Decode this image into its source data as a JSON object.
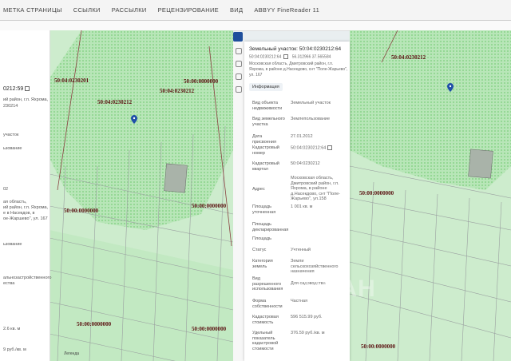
{
  "ribbon": {
    "tabs": [
      "МЕТКА СТРАНИЦЫ",
      "ССЫЛКИ",
      "РАССЫЛКИ",
      "РЕЦЕНЗИРОВАНИЕ",
      "ВИД",
      "ABBYY FineReader 11"
    ]
  },
  "sidebar": {
    "cadastral_number": "0212:59",
    "lines": [
      "ий район, г.п. Яхрома,",
      "230214",
      "участок",
      "",
      "ьзование",
      "",
      "",
      "02",
      "ая область,",
      "ий район, г.п. Яхрома,",
      "е в Насекдов, в",
      "ое-Жаршево\", ул. 167",
      "",
      "ьзование",
      "",
      "",
      "",
      "альнозастройственного",
      "ества",
      "",
      "",
      "",
      "",
      "",
      "",
      "2.6 кв. м",
      "",
      "",
      "9 руб./кв. м"
    ]
  },
  "card": {
    "title": "Земельный участок: 50:04:0230212:64",
    "sub_cadastral": "50:04:0230212:64",
    "sub_coords": "56.312966 37.565584",
    "address_line": "Московская область, Дмитровский район, г.п. Яхрома, в районе д.Насекдово, снт \"Поле-Жарьево\", ул. 167",
    "tab_label": "Информация",
    "rows": [
      {
        "k": "Вид объекта недвижимости",
        "v": "Земельный участок"
      },
      {
        "k": "Вид земельного участка",
        "v": "Землепользование"
      },
      {
        "k": "Дата присвоения",
        "v": "27.01.2012"
      },
      {
        "k": "Кадастровый номер",
        "v": "50:04:0230212:64"
      },
      {
        "k": "Кадастровый квартал",
        "v": "50:04:0230212"
      },
      {
        "k": "Адрес",
        "v": "Московская область, Дмитровский район, г.п. Яхрома, в районе д.Насекдово, снт \"Поле-Жарьево\", ул.158"
      },
      {
        "k": "Площадь уточненная",
        "v": "1 001 кв. м"
      },
      {
        "k": "Площадь декларированная",
        "v": ""
      },
      {
        "k": "Площадь",
        "v": ""
      },
      {
        "k": "Статус",
        "v": "Учтенный"
      },
      {
        "k": "Категория земель",
        "v": "Земли сельскохозяйственного назначения"
      },
      {
        "k": "Вид разрешенного использования",
        "v": "Для садоводства"
      },
      {
        "k": "Форма собственности",
        "v": "Частная"
      },
      {
        "k": "Кадастровая стоимость",
        "v": "596 515.99 руб."
      },
      {
        "k": "Удельный показатель кадастровой стоимости",
        "v": "376.59 руб./кв. м"
      }
    ]
  },
  "map_labels": {
    "left": [
      "50:04:0230201",
      "50:00:0000000",
      "50:04:0230212",
      "50:04:0230212",
      "50:00:0000000",
      "50:00:0000000",
      "50:00:0000000",
      "50:00:0000000"
    ],
    "right": [
      "50:04:0230212",
      "50:00:0000000",
      "50:00:0000000"
    ]
  },
  "legend_label": "Легенда",
  "watermark": "ЦИАН",
  "colors": {
    "map_fill": "#b8e6b8",
    "map_dense": "#8fd98f",
    "parcel_line": "#9aa0a0",
    "label": "#5a1010",
    "marker": "#1f4fa8",
    "plot_gray": "#a9b3a9"
  }
}
